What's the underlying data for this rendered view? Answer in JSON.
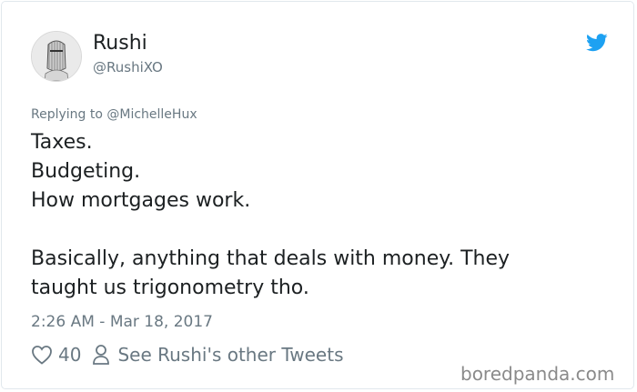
{
  "author": {
    "name": "Rushi",
    "handle": "@RushiXO"
  },
  "reply_to": "Replying to @MichelleHux",
  "tweet": {
    "lines": [
      "Taxes.",
      "Budgeting.",
      "How mortgages work."
    ],
    "paragraph": [
      "Basically, anything that deals with money. They",
      "taught us trigonometry tho."
    ],
    "timestamp": "2:26 AM - Mar 18, 2017"
  },
  "actions": {
    "likes": "40",
    "profile_link": "See Rushi's other Tweets"
  },
  "watermark": "boredpanda.com",
  "icons": {
    "platform": "twitter-bird-icon",
    "like": "heart-icon",
    "profile": "person-icon"
  },
  "colors": {
    "brand": "#1da1f2",
    "text": "#1c2022",
    "muted": "#697882"
  }
}
